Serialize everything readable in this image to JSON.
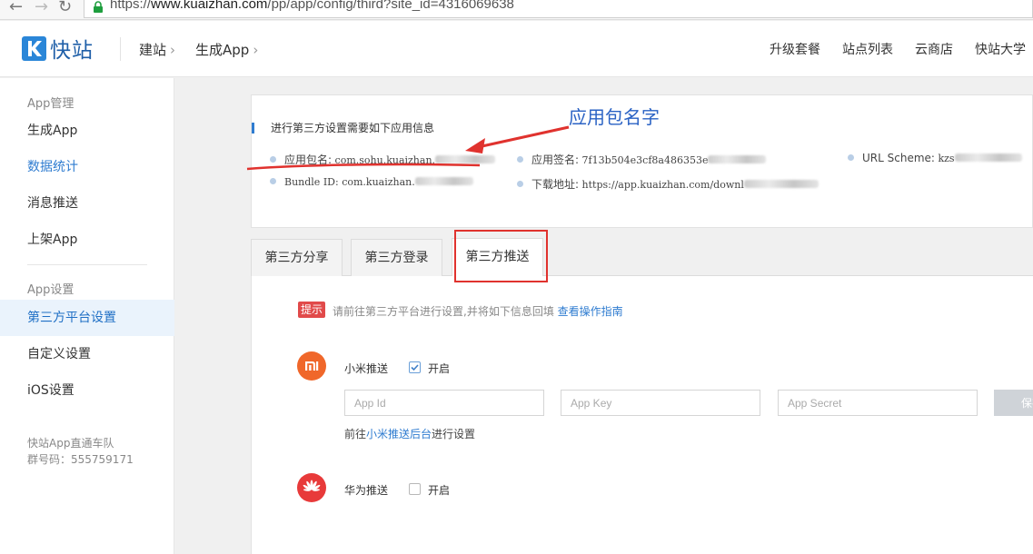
{
  "browser": {
    "url_prefix": "https://",
    "url_host": "www.kuaizhan.com",
    "url_path": "/pp/app/config/third?site_id=4316069638"
  },
  "header": {
    "logo_text": "快站",
    "breadcrumbs": [
      {
        "label": "建站"
      },
      {
        "label": "生成App"
      }
    ],
    "nav": [
      {
        "label": "升级套餐"
      },
      {
        "label": "站点列表"
      },
      {
        "label": "云商店"
      },
      {
        "label": "快站大学"
      }
    ],
    "chevron": "›"
  },
  "sidebar": {
    "group_manage": "App管理",
    "items_manage": [
      {
        "label": "生成App"
      },
      {
        "label": "数据统计"
      },
      {
        "label": "消息推送"
      },
      {
        "label": "上架App"
      }
    ],
    "group_settings": "App设置",
    "items_settings": [
      {
        "label": "第三方平台设置"
      },
      {
        "label": "自定义设置"
      },
      {
        "label": "iOS设置"
      }
    ],
    "footer_line1": "快站App直通车队",
    "footer_line2": "群号码：555759171"
  },
  "info_card": {
    "title": "进行第三方设置需要如下应用信息",
    "package_name_label": "应用包名:",
    "package_name_value": "com.sohu.kuaizhan.",
    "app_signature_label": "应用签名:",
    "app_signature_value": "7f13b504e3cf8a486353e",
    "url_scheme_label": "URL Scheme:",
    "url_scheme_value": "kzs",
    "bundle_id_label": "Bundle ID:",
    "bundle_id_value": "com.kuaizhan.",
    "download_label": "下载地址:",
    "download_value": "https://app.kuaizhan.com/downl"
  },
  "annotation": {
    "text": "应用包名字",
    "color": "#e0322e"
  },
  "tabs": [
    {
      "label": "第三方分享"
    },
    {
      "label": "第三方登录"
    },
    {
      "label": "第三方推送",
      "active": true
    }
  ],
  "tip": {
    "badge": "提示",
    "text": "请前往第三方平台进行设置,并将如下信息回填",
    "link": "查看操作指南"
  },
  "xiaomi": {
    "name": "小米推送",
    "enabled_label": "开启",
    "enabled": true,
    "brand_color": "#f0672a",
    "fields": {
      "app_id": {
        "placeholder": "App Id",
        "value": ""
      },
      "app_key": {
        "placeholder": "App Key",
        "value": ""
      },
      "app_secret": {
        "placeholder": "App Secret",
        "value": ""
      }
    },
    "save_label": "保存",
    "hint_prefix": "前往",
    "hint_link": "小米推送后台",
    "hint_suffix": "进行设置"
  },
  "huawei": {
    "name": "华为推送",
    "enabled_label": "开启",
    "enabled": false,
    "brand_color": "#e83a3a"
  }
}
